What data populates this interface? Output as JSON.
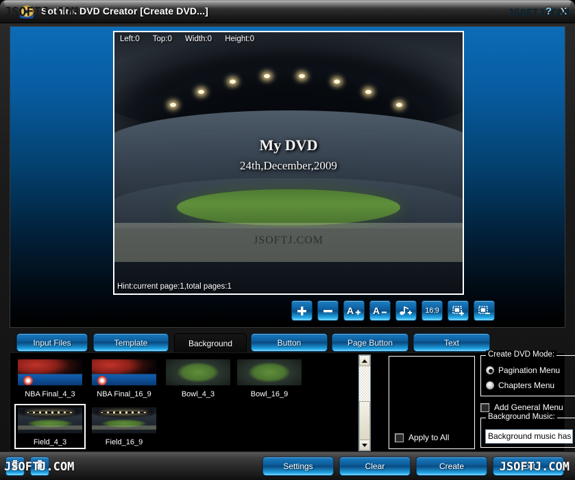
{
  "window": {
    "title": "Sothink DVD Creator [Create DVD...]",
    "help_label": "?",
    "close_label": "X",
    "app_icon": "dvd-disc-icon"
  },
  "preview": {
    "coords": "Left:0      Top:0      Width:0      Height:0",
    "dvd_title": "My DVD",
    "dvd_date": "24th,December,2009",
    "watermark": "JSOFTJ.COM",
    "hint": "Hint:current page:1,total pages:1"
  },
  "edit_toolbar": [
    {
      "name": "add-item-button",
      "icon": "plus-icon",
      "label": ""
    },
    {
      "name": "remove-item-button",
      "icon": "minus-icon",
      "label": ""
    },
    {
      "name": "increase-font-button",
      "icon": "font-increase-icon",
      "label": "A+"
    },
    {
      "name": "decrease-font-button",
      "icon": "font-decrease-icon",
      "label": "A-"
    },
    {
      "name": "add-music-button",
      "icon": "music-note-plus-icon",
      "label": ""
    },
    {
      "name": "aspect-ratio-button",
      "icon": "aspect-ratio-icon",
      "label": "16:9"
    },
    {
      "name": "add-page-button",
      "icon": "page-add-icon",
      "label": ""
    },
    {
      "name": "remove-page-button",
      "icon": "page-remove-icon",
      "label": ""
    }
  ],
  "tabs": [
    {
      "label": "Input Files",
      "active": false
    },
    {
      "label": "Template",
      "active": false
    },
    {
      "label": "Background",
      "active": true
    },
    {
      "label": "Button",
      "active": false
    },
    {
      "label": "Page Button",
      "active": false
    },
    {
      "label": "Text",
      "active": false
    }
  ],
  "thumbnails": [
    {
      "label": "NBA Final_4_3",
      "art": "art-nba",
      "selected": false
    },
    {
      "label": "NBA Final_16_9",
      "art": "art-nba",
      "selected": false
    },
    {
      "label": "Bowl_4_3",
      "art": "art-bowl",
      "selected": false
    },
    {
      "label": "Bowl_16_9",
      "art": "art-bowl",
      "selected": false
    },
    {
      "label": "Field_4_3",
      "art": "art-field",
      "selected": true
    },
    {
      "label": "Field_16_9",
      "art": "art-field",
      "selected": false
    }
  ],
  "apply_panel": {
    "apply_to_all_label": "Apply to All",
    "apply_to_all_checked": false
  },
  "options": {
    "dvd_mode_legend": "Create DVD Mode:",
    "modes": [
      {
        "label": "Pagination Menu",
        "checked": true
      },
      {
        "label": "Chapters Menu",
        "checked": false
      }
    ],
    "add_general_menu_label": "Add General Menu",
    "add_general_menu_checked": false,
    "bg_music_legend": "Background Music:",
    "bg_music_value": "Background music has not been set."
  },
  "bottom_bar": {
    "icon_buttons": [
      {
        "name": "burn-disc-button",
        "icon": "film-strip-icon"
      },
      {
        "name": "open-project-button",
        "icon": "film-strip-icon"
      }
    ],
    "buttons": [
      {
        "label": "Settings",
        "name": "settings-button"
      },
      {
        "label": "Clear",
        "name": "clear-button"
      },
      {
        "label": "Create",
        "name": "create-button"
      },
      {
        "label": "Exit",
        "name": "exit-button"
      }
    ]
  },
  "watermarks": {
    "top_left": "JSOFTJ.COM",
    "top_right": "JSOFTJ.COM",
    "bottom_left": "JSOFTJ.COM",
    "bottom_right": "JSOFTJ.COM"
  },
  "colors": {
    "accent_blue": "#1a7cc0",
    "stage_blue": "#0c6cb6",
    "selection_white": "#ffffff",
    "panel_black": "#000000"
  }
}
